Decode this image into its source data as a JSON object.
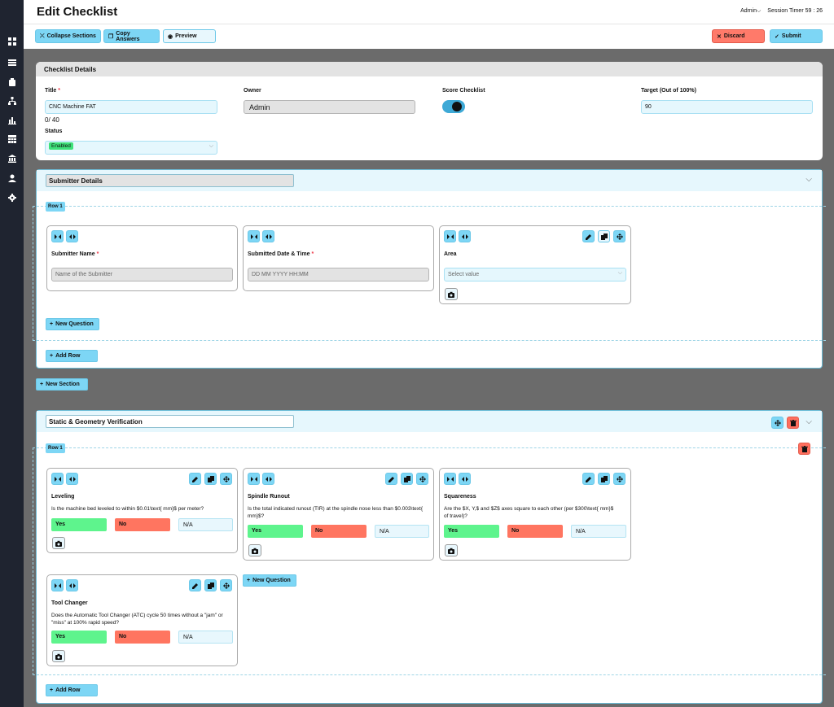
{
  "header": {
    "title": "Edit Checklist",
    "user": "Admin",
    "timer_label": "Session Timer 59 : 26"
  },
  "toolbar": {
    "collapse": "Collapse Sections",
    "copy": "Copy Answers",
    "preview": "Preview",
    "discard": "Discard",
    "submit": "Submit"
  },
  "details": {
    "heading": "Checklist Details",
    "title_label": "Title",
    "title_value": "CNC Machine FAT",
    "char_count": "0/ 40",
    "owner_label": "Owner",
    "owner_value": "Admin",
    "score_label": "Score Checklist",
    "score_on": true,
    "target_label": "Target (Out of 100%)",
    "target_value": "90",
    "status_label": "Status",
    "status_value": "Enabled"
  },
  "submitter": {
    "name": "Submitter Details",
    "row_label": "Row 1",
    "q1": {
      "label": "Submitter Name",
      "placeholder": "Name of the Submitter"
    },
    "q2": {
      "label": "Submitted Date & Time",
      "placeholder": "DD MM YYYY HH:MM"
    },
    "q3": {
      "label": "Area",
      "placeholder": "Select value"
    },
    "new_question": "New Question",
    "add_row": "Add Row"
  },
  "new_section": "New Section",
  "geometry": {
    "name": "Static & Geometry Verification",
    "row_label": "Row 1",
    "questions": [
      {
        "title": "Leveling",
        "text": "Is the machine bed leveled to within $0.01\\text{ mm}$ per meter?",
        "yes": "Yes",
        "no": "No",
        "na": "N/A"
      },
      {
        "title": "Spindle Runout",
        "text": "Is the total indicated runout (TIR) at the spindle nose less than $0.003\\text{ mm}$?",
        "yes": "Yes",
        "no": "No",
        "na": "N/A"
      },
      {
        "title": "Squareness",
        "text": "Are the $X, Y,$ and $Z$ axes square to each other (per $300\\text{ mm}$ of travel)?",
        "yes": "Yes",
        "no": "No",
        "na": "N/A"
      },
      {
        "title": "Tool Changer",
        "text": "Does the Automatic Tool Changer (ATC) cycle 50 times without a \"jam\" or \"miss\" at 100% rapid speed?",
        "yes": "Yes",
        "no": "No",
        "na": "N/A"
      }
    ],
    "new_question": "New Question",
    "add_row": "Add Row"
  },
  "icons": [
    "dashboard-icon",
    "list-icon",
    "clipboard-icon",
    "hierarchy-icon",
    "chart-icon",
    "table-icon",
    "building-icon",
    "user-icon",
    "gear-icon",
    "collapse-icon",
    "copy-icon",
    "eye-icon",
    "close-icon",
    "check-icon",
    "edit-icon",
    "move-icon",
    "trash-icon",
    "camera-icon",
    "plus-icon",
    "chevron-down-icon"
  ]
}
